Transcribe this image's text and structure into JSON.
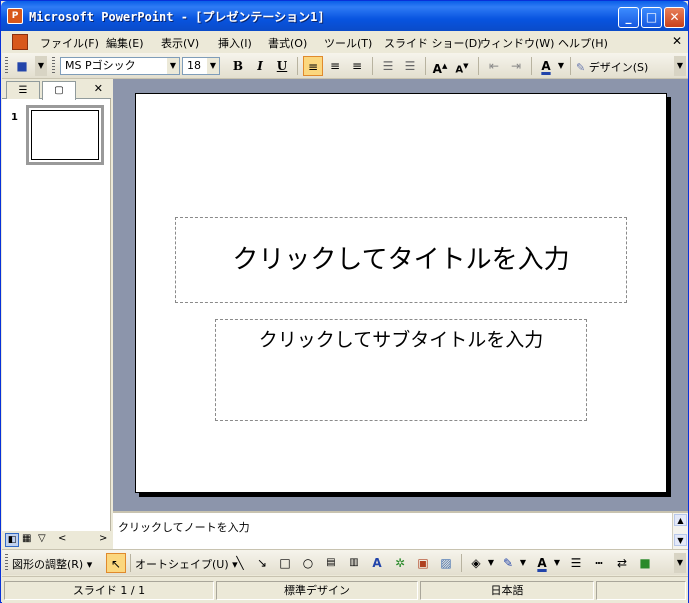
{
  "window": {
    "title": "Microsoft PowerPoint - [プレゼンテーション1]",
    "app_icon": "P"
  },
  "menu": [
    {
      "label": "ファイル(F)"
    },
    {
      "label": "編集(E)"
    },
    {
      "label": "表示(V)"
    },
    {
      "label": "挿入(I)"
    },
    {
      "label": "書式(O)"
    },
    {
      "label": "ツール(T)"
    },
    {
      "label": "スライド ショー(D)"
    },
    {
      "label": "ウィンドウ(W)"
    },
    {
      "label": "ヘルプ(H)"
    }
  ],
  "toolbar": {
    "font_name": "MS Pゴシック",
    "font_size": "18",
    "bold": "B",
    "italic": "I",
    "underline": "U",
    "design_label": "デザイン(S)"
  },
  "panel": {
    "slide_number": "1"
  },
  "slide": {
    "title_placeholder": "クリックしてタイトルを入力",
    "subtitle_placeholder": "クリックしてサブタイトルを入力"
  },
  "notes": {
    "placeholder": "クリックしてノートを入力"
  },
  "drawing": {
    "adjust_label": "図形の調整(R)",
    "autoshape_label": "オートシェイプ(U)"
  },
  "status": {
    "slide": "スライド 1 / 1",
    "design": "標準デザイン",
    "language": "日本語"
  }
}
